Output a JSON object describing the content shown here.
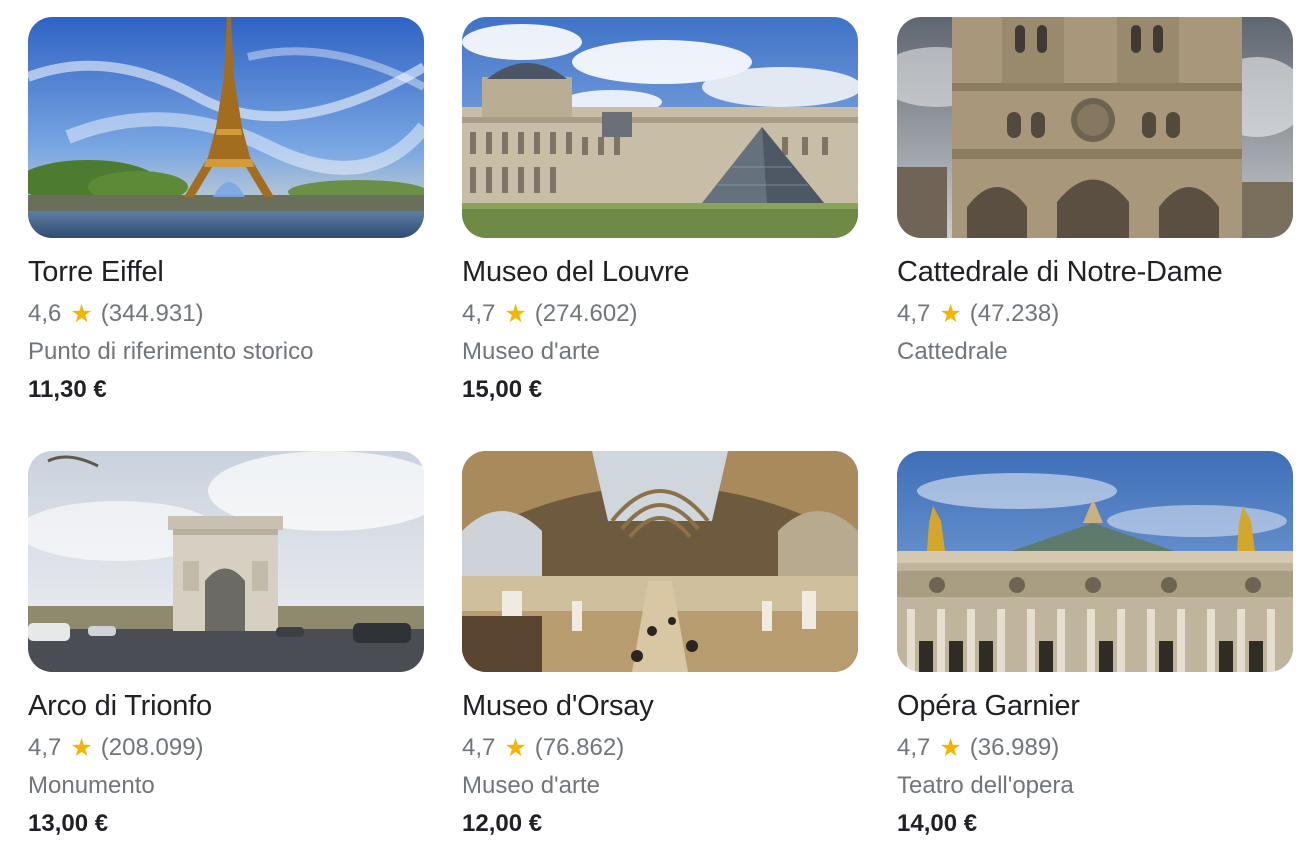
{
  "cards": [
    {
      "title": "Torre Eiffel",
      "rating": "4,6",
      "reviews": "(344.931)",
      "category": "Punto di riferimento storico",
      "price": "11,30 €"
    },
    {
      "title": "Museo del Louvre",
      "rating": "4,7",
      "reviews": "(274.602)",
      "category": "Museo d'arte",
      "price": "15,00 €"
    },
    {
      "title": "Cattedrale di Notre-Dame",
      "rating": "4,7",
      "reviews": "(47.238)",
      "category": "Cattedrale",
      "price": ""
    },
    {
      "title": "Arco di Trionfo",
      "rating": "4,7",
      "reviews": "(208.099)",
      "category": "Monumento",
      "price": "13,00 €"
    },
    {
      "title": "Museo d'Orsay",
      "rating": "4,7",
      "reviews": "(76.862)",
      "category": "Museo d'arte",
      "price": "12,00 €"
    },
    {
      "title": "Opéra Garnier",
      "rating": "4,7",
      "reviews": "(36.989)",
      "category": "Teatro dell'opera",
      "price": "14,00 €"
    }
  ],
  "colors": {
    "star": "#f4b400",
    "title": "#202124",
    "secondary": "#70757a"
  }
}
